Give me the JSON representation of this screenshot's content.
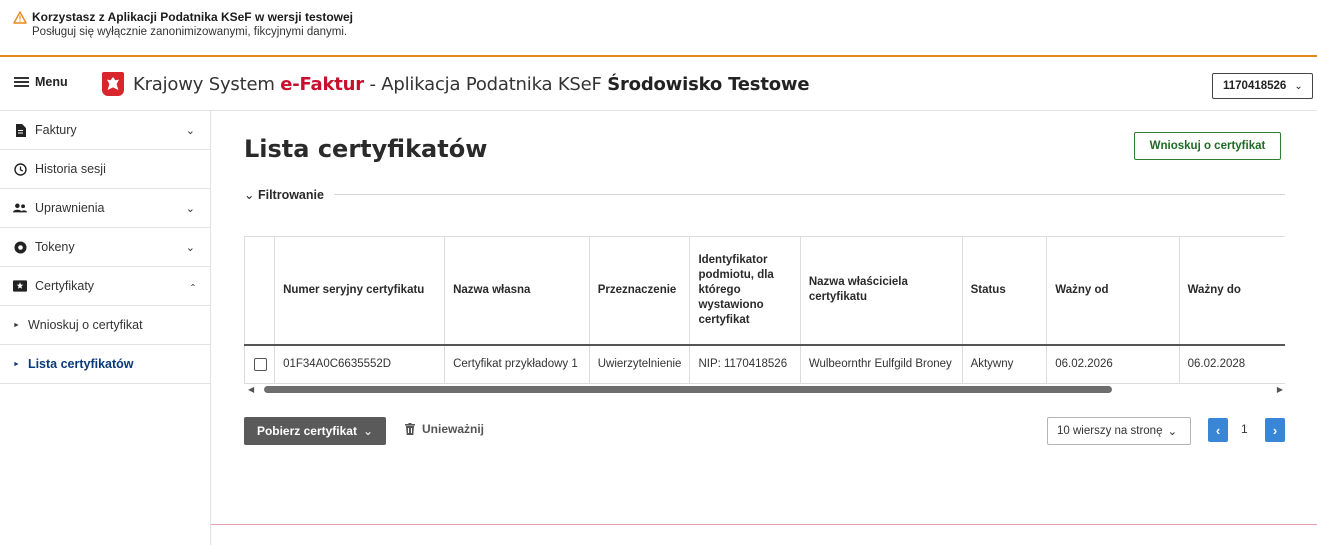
{
  "banner": {
    "title": "Korzystasz z Aplikacji Podatnika KSeF w wersji testowej",
    "subtitle": "Posługuj się wyłącznie zanonimizowanymi, fikcyjnymi danymi.",
    "icon": "warning-icon",
    "accent_color": "#e8891b"
  },
  "header": {
    "menu_label": "Menu",
    "title_prefix": "Krajowy System ",
    "title_brand_e": "e-",
    "title_brand_rest": "Faktur",
    "title_suffix": " - Aplikacja Podatnika KSeF ",
    "title_env": "Środowisko Testowe",
    "nip_value": "1170418526"
  },
  "sidebar": {
    "items": [
      {
        "label": "Faktury",
        "icon": "document-icon",
        "chevron": "⌄"
      },
      {
        "label": "Historia sesji",
        "icon": "clock-icon"
      },
      {
        "label": "Uprawnienia",
        "icon": "users-icon",
        "chevron": "⌄"
      },
      {
        "label": "Tokeny",
        "icon": "token-icon",
        "chevron": "⌄"
      },
      {
        "label": "Certyfikaty",
        "icon": "certificate-icon",
        "chevron": "^"
      }
    ],
    "subitems": [
      {
        "label": "Wnioskuj o certyfikat"
      },
      {
        "label": "Lista certyfikatów",
        "active": true
      }
    ]
  },
  "main": {
    "title": "Lista certyfikatów",
    "request_button": "Wnioskuj o certyfikat",
    "filter_label": "Filtrowanie",
    "table": {
      "headers": [
        "",
        "Numer seryjny certyfikatu",
        "Nazwa własna",
        "Przeznaczenie",
        "Identyfikator podmiotu, dla którego wystawiono certyfikat",
        "Nazwa właściciela certyfikatu",
        "Status",
        "Ważny od",
        "Ważny do"
      ],
      "rows": [
        [
          "",
          "01F34A0C6635552D",
          "Certyfikat przykładowy 1",
          "Uwierzytelnienie",
          "NIP: 1170418526",
          "Wulbeornthr Eulfgild Broney",
          "Aktywny",
          "06.02.2026",
          "06.02.2028"
        ]
      ]
    },
    "download_button": "Pobierz certyfikat",
    "revoke_button": "Unieważnij",
    "rows_per_page": "10 wierszy na stronę",
    "current_page": "1"
  },
  "colors": {
    "primary_green": "#2e7d32",
    "pager_blue": "#3a86d6",
    "brand_red": "#c8102e",
    "active_nav": "#0b3a7a"
  }
}
